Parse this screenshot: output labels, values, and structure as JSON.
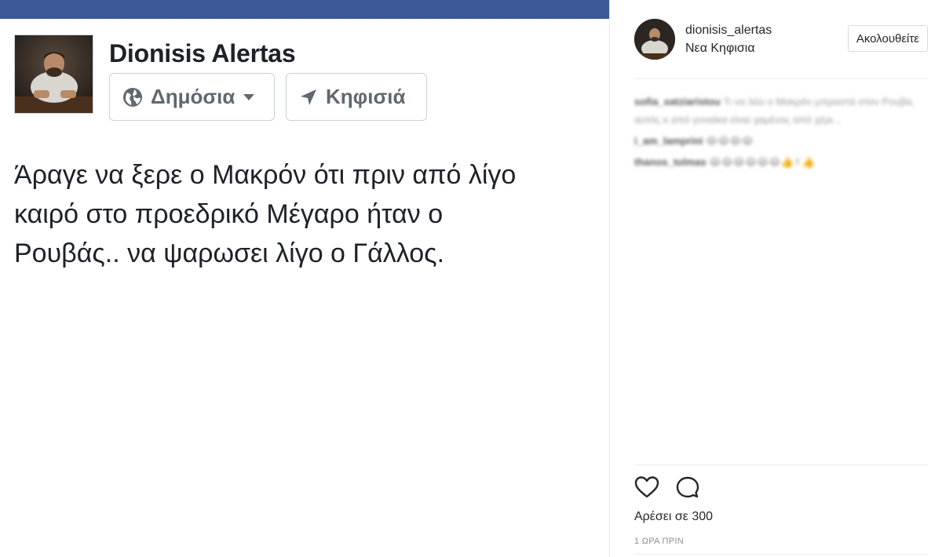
{
  "facebook": {
    "author_name": "Dionisis Alertas",
    "privacy_label": "Δημόσια",
    "location_label": "Κηφισιά",
    "post_text": "Άραγε να ξερε ο Μακρόν ότι πριν από λίγο\nκαιρό  στο προεδρικό Μέγαρο ήταν ο\nΡουβάς.. να ψαρωσει λίγο ο Γάλλος.",
    "colors": {
      "topbar": "#3b5998",
      "pill_text": "#606770",
      "name_text": "#1d2129"
    },
    "icons": {
      "privacy": "globe-icon",
      "privacy_dropdown": "caret-down-icon",
      "location": "location-arrow-icon"
    }
  },
  "instagram": {
    "username": "dionisis_alertas",
    "location": "Νεα Κηφισια",
    "follow_label": "Ακολουθείτε",
    "comments": [
      {
        "user": "sofia_satziaristou",
        "text": "Τι να λέει ο Μακρόν μπροστά στον Ρουβα, αυτός κ από γυναίκα είναι χαμένος από χέρι..."
      },
      {
        "user": "i_am_lamprini",
        "text": "😂😂😂😂"
      },
      {
        "user": "thanos_tolmas",
        "text": "😂😂😂😂😂😂👍✌👍"
      }
    ],
    "likes_label": "Αρέσει σε 300",
    "time_label": "1 ΩΡΑ ΠΡΙΝ",
    "icons": {
      "like": "heart-icon",
      "comment": "comment-icon"
    }
  }
}
